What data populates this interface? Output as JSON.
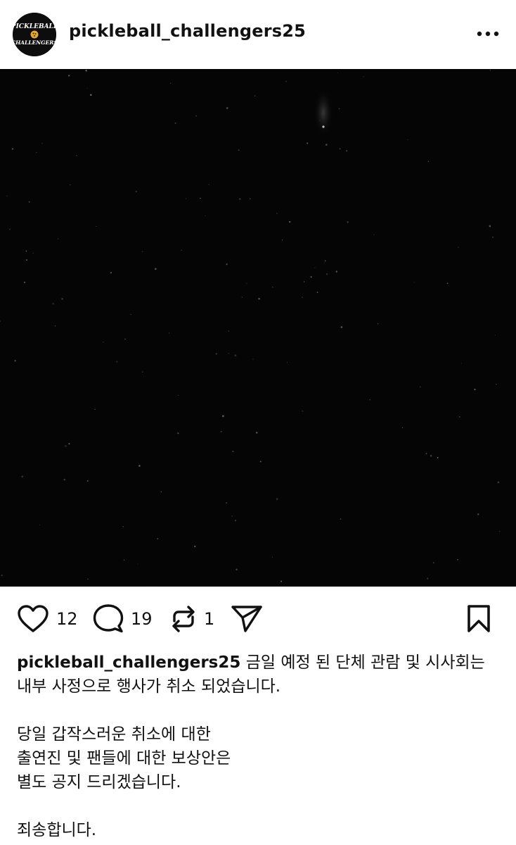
{
  "post": {
    "username": "pickleball_challengers25",
    "avatar": {
      "icon": "pickleball-challengers-logo",
      "text_top": "PICKLEBALL",
      "text_bottom": "CHALLENGERS",
      "bg_color": "#0d0d0d",
      "ball_color": "#e2a73a"
    },
    "more_icon": "more-horizontal-icon",
    "media": {
      "description_color": "#050505"
    },
    "actions": {
      "like": {
        "icon": "heart-icon",
        "count": "12"
      },
      "comment": {
        "icon": "comment-icon",
        "count": "19"
      },
      "repost": {
        "icon": "repost-icon",
        "count": "1"
      },
      "share": {
        "icon": "send-icon"
      },
      "save": {
        "icon": "bookmark-icon"
      }
    },
    "caption": {
      "first_line": "금일 예정 된 단체 관람 및 시사회는",
      "line2": "내부 사정으로 행사가 취소 되었습니다.",
      "line3": "당일 갑작스러운 취소에 대한",
      "line4": "출연진 및 팬들에 대한 보상안은",
      "line5": "별도 공지 드리겠습니다.",
      "line6": "죄송합니다."
    }
  }
}
